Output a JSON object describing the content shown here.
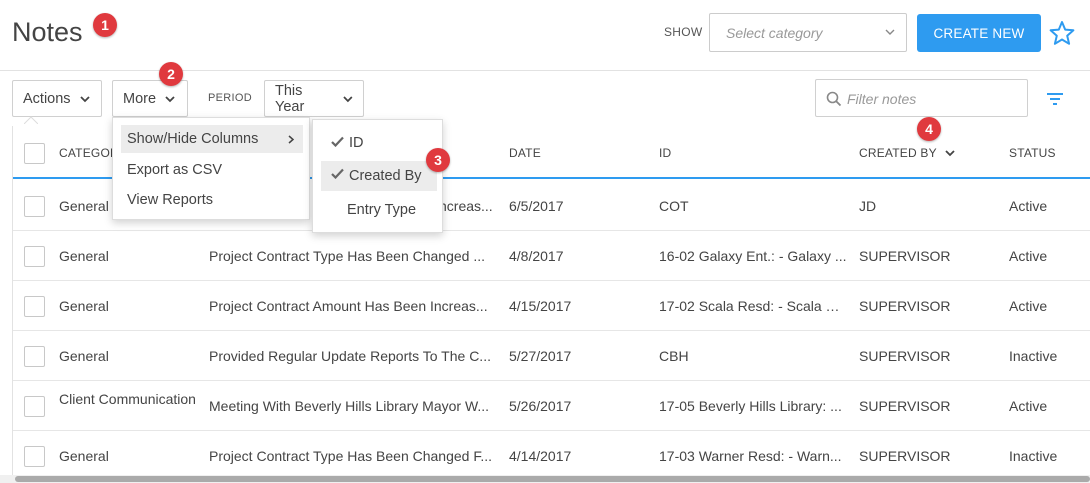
{
  "header": {
    "title": "Notes",
    "show_label": "SHOW",
    "category_placeholder": "Select category",
    "create_button": "CREATE NEW"
  },
  "callouts": [
    "1",
    "2",
    "3",
    "4"
  ],
  "toolbar": {
    "actions_label": "Actions",
    "more_label": "More",
    "period_label": "PERIOD",
    "period_value": "This Year",
    "filter_placeholder": "Filter notes"
  },
  "more_menu": {
    "items": [
      "Show/Hide Columns",
      "Export as CSV",
      "View Reports"
    ]
  },
  "columns_submenu": {
    "items": [
      {
        "label": "ID",
        "checked": true
      },
      {
        "label": "Created By",
        "checked": true
      },
      {
        "label": "Entry Type",
        "checked": false
      }
    ]
  },
  "table": {
    "headers": [
      "CATEGORY",
      "DATE",
      "ID",
      "CREATED BY",
      "STATUS"
    ],
    "header_visible": {
      "category": "CATEGOR"
    },
    "rows": [
      {
        "category": "General",
        "subject": "Project Contract Amount Has Been Increas...",
        "subject_visible": "ncreas...",
        "date": "6/5/2017",
        "id": "COT",
        "created_by": "JD",
        "status": "Active"
      },
      {
        "category": "General",
        "subject": "Project Contract Type Has Been Changed ...",
        "date": "4/8/2017",
        "id": "16-02 Galaxy Ent.: - Galaxy ...",
        "created_by": "SUPERVISOR",
        "status": "Active"
      },
      {
        "category": "General",
        "subject": "Project Contract Amount Has Been Increas...",
        "date": "4/15/2017",
        "id": "17-02 Scala Resd: - Scala Re...",
        "created_by": "SUPERVISOR",
        "status": "Active"
      },
      {
        "category": "General",
        "subject": "Provided Regular Update Reports To The C...",
        "date": "5/27/2017",
        "id": "CBH",
        "created_by": "SUPERVISOR",
        "status": "Inactive"
      },
      {
        "category": "Client Communication",
        "subject": "Meeting With Beverly Hills Library Mayor W...",
        "date": "5/26/2017",
        "id": "17-05 Beverly Hills Library: ...",
        "created_by": "SUPERVISOR",
        "status": "Active"
      },
      {
        "category": "General",
        "subject": "Project Contract Type Has Been Changed F...",
        "date": "4/14/2017",
        "id": "17-03 Warner Resd: - Warn...",
        "created_by": "SUPERVISOR",
        "status": "Inactive"
      }
    ]
  },
  "colors": {
    "accent": "#2e9bf0",
    "callout": "#e0393e"
  },
  "icons": [
    "chevron-down-icon",
    "star-icon",
    "search-icon",
    "filter-icon",
    "check-icon",
    "chevron-right-icon"
  ]
}
